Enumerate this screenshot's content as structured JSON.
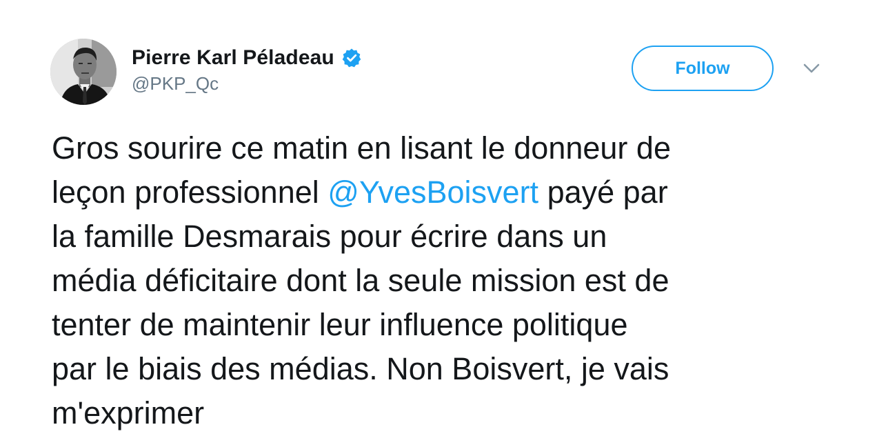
{
  "author": {
    "display_name": "Pierre Karl Péladeau",
    "handle": "@PKP_Qc",
    "verified": true,
    "avatar_icon": "person-portrait-avatar"
  },
  "actions": {
    "follow_label": "Follow",
    "menu_icon": "chevron-down-icon"
  },
  "tweet": {
    "line1": "Gros sourire ce matin en lisant le donneur de",
    "line2_before": "leçon professionnel ",
    "line2_mention": "@YvesBoisvert",
    "line2_after": " payé par",
    "line3": "la famille Desmarais pour écrire dans un",
    "line4": "média déficitaire dont la seule mission est de",
    "line5": "tenter de maintenir leur influence politique",
    "line6": "par le biais des médias. Non Boisvert, je vais",
    "line7": "m'exprimer"
  },
  "colors": {
    "accent": "#1da1f2",
    "text": "#14171a",
    "secondary_text": "#657786"
  }
}
